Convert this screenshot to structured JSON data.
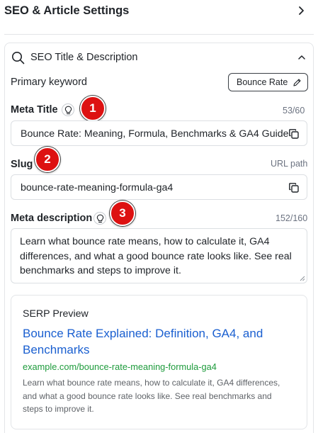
{
  "header": {
    "title": "SEO & Article Settings",
    "chevron_icon": "chevron-right-icon"
  },
  "section": {
    "title": "SEO Title & Description",
    "icon": "search-icon",
    "chevron_icon": "chevron-up-icon"
  },
  "primary_keyword": {
    "label": "Primary keyword",
    "value": "Bounce Rate",
    "icon": "pencil-icon"
  },
  "meta_title": {
    "label": "Meta Title",
    "hint_icon": "lightbulb-icon",
    "counter": "53/60",
    "value": "Bounce Rate: Meaning, Formula, Benchmarks & GA4 Guide",
    "copy_icon": "copy-icon"
  },
  "slug": {
    "label": "Slug",
    "helper": "URL path",
    "value": "bounce-rate-meaning-formula-ga4",
    "copy_icon": "copy-icon"
  },
  "meta_description": {
    "label": "Meta description",
    "hint_icon": "lightbulb-icon",
    "counter": "152/160",
    "value": "Learn what bounce rate means, how to calculate it, GA4 differences, and what a good bounce rate looks like. See real benchmarks and steps to improve it."
  },
  "serp_preview": {
    "label": "SERP Preview",
    "title": "Bounce Rate Explained: Definition, GA4, and Benchmarks",
    "url": "example.com/bounce-rate-meaning-formula-ga4",
    "description": "Learn what bounce rate means, how to calculate it, GA4 differences, and what a good bounce rate looks like. See real benchmarks and steps to improve it."
  },
  "annotations": {
    "badge_1": "1",
    "badge_2": "2",
    "badge_3": "3"
  },
  "colors": {
    "badge": "#dd1111",
    "link": "#1a5fd0",
    "url": "#1e9b3c",
    "border": "#dcdfe3"
  }
}
